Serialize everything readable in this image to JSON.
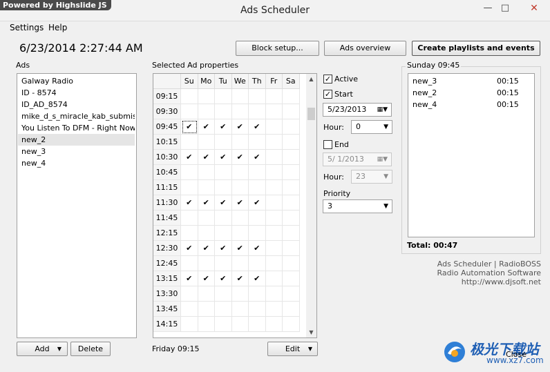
{
  "window": {
    "title": "Ads Scheduler",
    "powered_by": "Powered by  Highslide JS"
  },
  "menu": [
    "Settings",
    "Help"
  ],
  "clock": "6/23/2014 2:27:44 AM",
  "toolbar": {
    "block_setup": "Block setup...",
    "ads_overview": "Ads overview",
    "create_playlists": "Create playlists and events"
  },
  "ads": {
    "label": "Ads",
    "items": [
      "Galway Radio",
      "ID - 8574",
      "ID_AD_8574",
      "mike_d_s_miracle_kab_submiss...",
      "You Listen To DFM - Right Now!",
      "new_2",
      "new_3",
      "new_4"
    ],
    "selected": "new_2",
    "add_label": "Add",
    "delete_label": "Delete"
  },
  "grid": {
    "label": "Selected Ad properties",
    "days": [
      "Su",
      "Mo",
      "Tu",
      "We",
      "Th",
      "Fr",
      "Sa"
    ],
    "rows": [
      {
        "time": "09:15",
        "checks": [
          0,
          0,
          0,
          0,
          0,
          0,
          0
        ]
      },
      {
        "time": "09:30",
        "checks": [
          0,
          0,
          0,
          0,
          0,
          0,
          0
        ]
      },
      {
        "time": "09:45",
        "checks": [
          1,
          1,
          1,
          1,
          1,
          0,
          0
        ]
      },
      {
        "time": "10:15",
        "checks": [
          0,
          0,
          0,
          0,
          0,
          0,
          0
        ]
      },
      {
        "time": "10:30",
        "checks": [
          1,
          1,
          1,
          1,
          1,
          0,
          0
        ]
      },
      {
        "time": "10:45",
        "checks": [
          0,
          0,
          0,
          0,
          0,
          0,
          0
        ]
      },
      {
        "time": "11:15",
        "checks": [
          0,
          0,
          0,
          0,
          0,
          0,
          0
        ]
      },
      {
        "time": "11:30",
        "checks": [
          1,
          1,
          1,
          1,
          1,
          0,
          0
        ]
      },
      {
        "time": "11:45",
        "checks": [
          0,
          0,
          0,
          0,
          0,
          0,
          0
        ]
      },
      {
        "time": "12:15",
        "checks": [
          0,
          0,
          0,
          0,
          0,
          0,
          0
        ]
      },
      {
        "time": "12:30",
        "checks": [
          1,
          1,
          1,
          1,
          1,
          0,
          0
        ]
      },
      {
        "time": "12:45",
        "checks": [
          0,
          0,
          0,
          0,
          0,
          0,
          0
        ]
      },
      {
        "time": "13:15",
        "checks": [
          1,
          1,
          1,
          1,
          1,
          0,
          0
        ]
      },
      {
        "time": "13:30",
        "checks": [
          0,
          0,
          0,
          0,
          0,
          0,
          0
        ]
      },
      {
        "time": "13:45",
        "checks": [
          0,
          0,
          0,
          0,
          0,
          0,
          0
        ]
      },
      {
        "time": "14:15",
        "checks": [
          0,
          0,
          0,
          0,
          0,
          0,
          0
        ]
      }
    ],
    "check_glyph": "✔",
    "status": "Friday 09:15",
    "edit_label": "Edit"
  },
  "props": {
    "active_label": "Active",
    "active_checked": true,
    "start_label": "Start",
    "start_checked": true,
    "start_date": "5/23/2013",
    "hour_label": "Hour:",
    "start_hour": "0",
    "end_label": "End",
    "end_checked": false,
    "end_date": "5/  1/2013",
    "end_hour_label": "Hour:",
    "end_hour": "23",
    "priority_label": "Priority",
    "priority": "3"
  },
  "sunday": {
    "label": "Sunday 09:45",
    "rows": [
      {
        "name": "new_3",
        "dur": "00:15"
      },
      {
        "name": "new_2",
        "dur": "00:15"
      },
      {
        "name": "new_4",
        "dur": "00:15"
      }
    ],
    "total": "Total: 00:47"
  },
  "info": {
    "line1": "Ads Scheduler | RadioBOSS",
    "line2": "Radio Automation Software",
    "line3": "http://www.djsoft.net"
  },
  "close_label": "Close",
  "watermark": {
    "text": "极光下载站",
    "url": "www.xz7.com"
  }
}
